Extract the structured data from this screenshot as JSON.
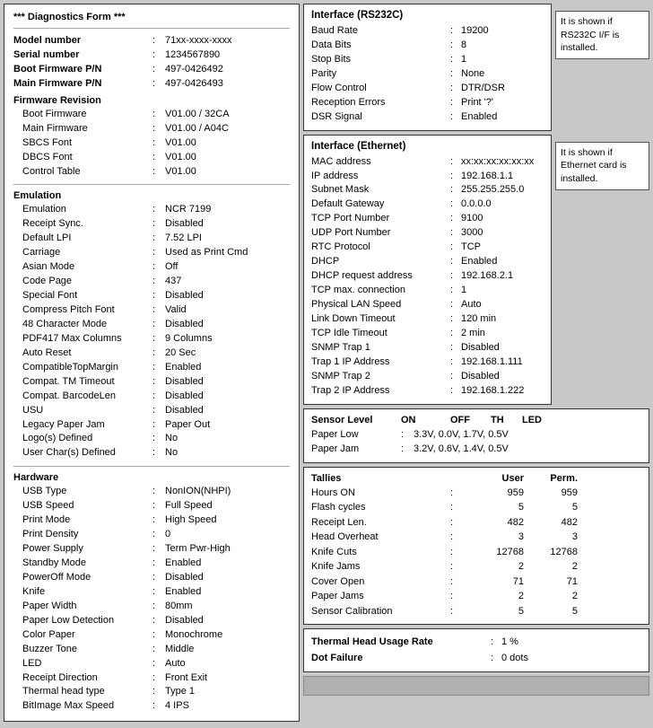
{
  "left": {
    "title": "*** Diagnostics Form ***",
    "model_number": {
      "label": "Model number",
      "value": "71xx-xxxx-xxxx"
    },
    "serial_number": {
      "label": "Serial number",
      "value": "1234567890"
    },
    "boot_firmware_pn": {
      "label": "Boot Firmware P/N",
      "value": "497-0426492"
    },
    "main_firmware_pn": {
      "label": "Main Firmware P/N",
      "value": "497-0426493"
    },
    "firmware_revision": "Firmware Revision",
    "boot_firmware": {
      "label": "Boot Firmware",
      "value": "V01.00 / 32CA"
    },
    "main_firmware": {
      "label": "Main Firmware",
      "value": "V01.00 / A04C"
    },
    "sbcs_font": {
      "label": "SBCS Font",
      "value": "V01.00"
    },
    "dbcs_font": {
      "label": "DBCS Font",
      "value": "V01.00"
    },
    "control_table": {
      "label": "Control Table",
      "value": "V01.00"
    },
    "emulation_title": "Emulation",
    "emulation_value": {
      "label": "Emulation",
      "value": "NCR 7199"
    },
    "receipt_sync": {
      "label": "Receipt Sync.",
      "value": "Disabled"
    },
    "default_lpi": {
      "label": "Default LPI",
      "value": "7.52 LPI"
    },
    "carriage": {
      "label": "Carriage",
      "value": "Used as Print Cmd"
    },
    "asian_mode": {
      "label": "Asian Mode",
      "value": "Off"
    },
    "code_page": {
      "label": "Code Page",
      "value": "437"
    },
    "special_font": {
      "label": "Special Font",
      "value": "Disabled"
    },
    "compress_pitch_font": {
      "label": "Compress Pitch Font",
      "value": "Valid"
    },
    "char_48_mode": {
      "label": "48 Character Mode",
      "value": "Disabled"
    },
    "pdf417_max_columns": {
      "label": "PDF417 Max Columns",
      "value": "9 Columns"
    },
    "auto_reset": {
      "label": "Auto Reset",
      "value": "20 Sec"
    },
    "compatible_top_margin": {
      "label": "CompatibleTopMargin",
      "value": "Enabled"
    },
    "compat_tm_timeout": {
      "label": "Compat. TM Timeout",
      "value": "Disabled"
    },
    "compat_barcode_len": {
      "label": "Compat. BarcodeLen",
      "value": "Disabled"
    },
    "usu": {
      "label": "USU",
      "value": "Disabled"
    },
    "legacy_paper_jam": {
      "label": "Legacy Paper Jam",
      "value": "Paper Out"
    },
    "logos_defined": {
      "label": "Logo(s) Defined",
      "value": "No"
    },
    "user_chars_defined": {
      "label": "User Char(s) Defined",
      "value": "No"
    },
    "hardware_title": "Hardware",
    "usb_type": {
      "label": "USB Type",
      "value": "NonION(NHPI)"
    },
    "usb_speed": {
      "label": "USB Speed",
      "value": "Full Speed"
    },
    "print_mode": {
      "label": "Print Mode",
      "value": "High Speed"
    },
    "print_density": {
      "label": "Print Density",
      "value": "0"
    },
    "power_supply": {
      "label": "Power Supply",
      "value": "Term Pwr-High"
    },
    "standby_mode": {
      "label": "Standby Mode",
      "value": "Enabled"
    },
    "poweroff_mode": {
      "label": "PowerOff Mode",
      "value": "Disabled"
    },
    "knife": {
      "label": "Knife",
      "value": "Enabled"
    },
    "paper_width": {
      "label": "Paper Width",
      "value": "80mm"
    },
    "paper_low_detection": {
      "label": "Paper Low Detection",
      "value": "Disabled"
    },
    "color_paper": {
      "label": "Color Paper",
      "value": "Monochrome"
    },
    "buzzer_tone": {
      "label": "Buzzer Tone",
      "value": "Middle"
    },
    "led": {
      "label": "LED",
      "value": "Auto"
    },
    "receipt_direction": {
      "label": "Receipt Direction",
      "value": "Front Exit"
    },
    "thermal_head_type": {
      "label": "Thermal head type",
      "value": "Type 1"
    },
    "bitimage_max_speed": {
      "label": "BitImage Max Speed",
      "value": "4 IPS"
    }
  },
  "rs232c": {
    "title": "Interface (RS232C)",
    "baud_rate": {
      "label": "Baud Rate",
      "value": "19200"
    },
    "data_bits": {
      "label": "Data Bits",
      "value": "8"
    },
    "stop_bits": {
      "label": "Stop Bits",
      "value": "1"
    },
    "parity": {
      "label": "Parity",
      "value": "None"
    },
    "flow_control": {
      "label": "Flow Control",
      "value": "DTR/DSR"
    },
    "reception_errors": {
      "label": "Reception Errors",
      "value": "Print '?'"
    },
    "dsr_signal": {
      "label": "DSR Signal",
      "value": "Enabled"
    },
    "note": "It is shown if RS232C I/F is installed."
  },
  "ethernet": {
    "title": "Interface (Ethernet)",
    "mac_address": {
      "label": "MAC address",
      "value": "xx:xx:xx:xx:xx:xx"
    },
    "ip_address": {
      "label": "IP address",
      "value": "192.168.1.1"
    },
    "subnet_mask": {
      "label": "Subnet Mask",
      "value": "255.255.255.0"
    },
    "default_gateway": {
      "label": "Default Gateway",
      "value": "0.0.0.0"
    },
    "tcp_port_number": {
      "label": "TCP Port Number",
      "value": "9100"
    },
    "udp_port_number": {
      "label": "UDP Port Number",
      "value": "3000"
    },
    "rtc_protocol": {
      "label": "RTC Protocol",
      "value": "TCP"
    },
    "dhcp": {
      "label": "DHCP",
      "value": "Enabled"
    },
    "dhcp_request_address": {
      "label": "DHCP request address",
      "value": "192.168.2.1"
    },
    "tcp_max_connection": {
      "label": "TCP max. connection",
      "value": "1"
    },
    "physical_lan_speed": {
      "label": "Physical LAN Speed",
      "value": "Auto"
    },
    "link_down_timeout": {
      "label": "Link Down Timeout",
      "value": "120 min"
    },
    "tcp_idle_timeout": {
      "label": "TCP Idle Timeout",
      "value": "2 min"
    },
    "snmp_trap1": {
      "label": "SNMP Trap 1",
      "value": "Disabled"
    },
    "trap1_ip_address": {
      "label": "Trap 1 IP Address",
      "value": "192.168.1.111"
    },
    "snmp_trap2": {
      "label": "SNMP Trap 2",
      "value": "Disabled"
    },
    "trap2_ip_address": {
      "label": "Trap 2 IP Address",
      "value": "192.168.1.222"
    },
    "note": "It is shown if Ethernet card is installed."
  },
  "sensor": {
    "title": "Sensor Level",
    "col_on": "ON",
    "col_off": "OFF",
    "col_th": "TH",
    "col_led": "LED",
    "paper_low": {
      "label": "Paper Low",
      "value": "3.3V, 0.0V, 1.7V, 0.5V"
    },
    "paper_jam": {
      "label": "Paper Jam",
      "value": "3.2V, 0.6V, 1.4V, 0.5V"
    }
  },
  "tallies": {
    "title": "Tallies",
    "col_user": "User",
    "col_perm": "Perm.",
    "hours_on": {
      "label": "Hours ON",
      "user": "959",
      "perm": "959"
    },
    "flash_cycles": {
      "label": "Flash cycles",
      "user": "5",
      "perm": "5"
    },
    "receipt_len": {
      "label": "Receipt Len.",
      "user": "482",
      "perm": "482"
    },
    "head_overheat": {
      "label": "Head Overheat",
      "user": "3",
      "perm": "3"
    },
    "knife_cuts": {
      "label": "Knife Cuts",
      "user": "12768",
      "perm": "12768"
    },
    "knife_jams": {
      "label": "Knife Jams",
      "user": "2",
      "perm": "2"
    },
    "cover_open": {
      "label": "Cover Open",
      "user": "71",
      "perm": "71"
    },
    "paper_jams": {
      "label": "Paper Jams",
      "user": "2",
      "perm": "2"
    },
    "sensor_calibration": {
      "label": "Sensor Calibration",
      "user": "5",
      "perm": "5"
    }
  },
  "bottom": {
    "thermal_head_usage": {
      "label": "Thermal Head Usage Rate",
      "value": "1 %"
    },
    "dot_failure": {
      "label": "Dot Failure",
      "value": "0 dots"
    }
  }
}
